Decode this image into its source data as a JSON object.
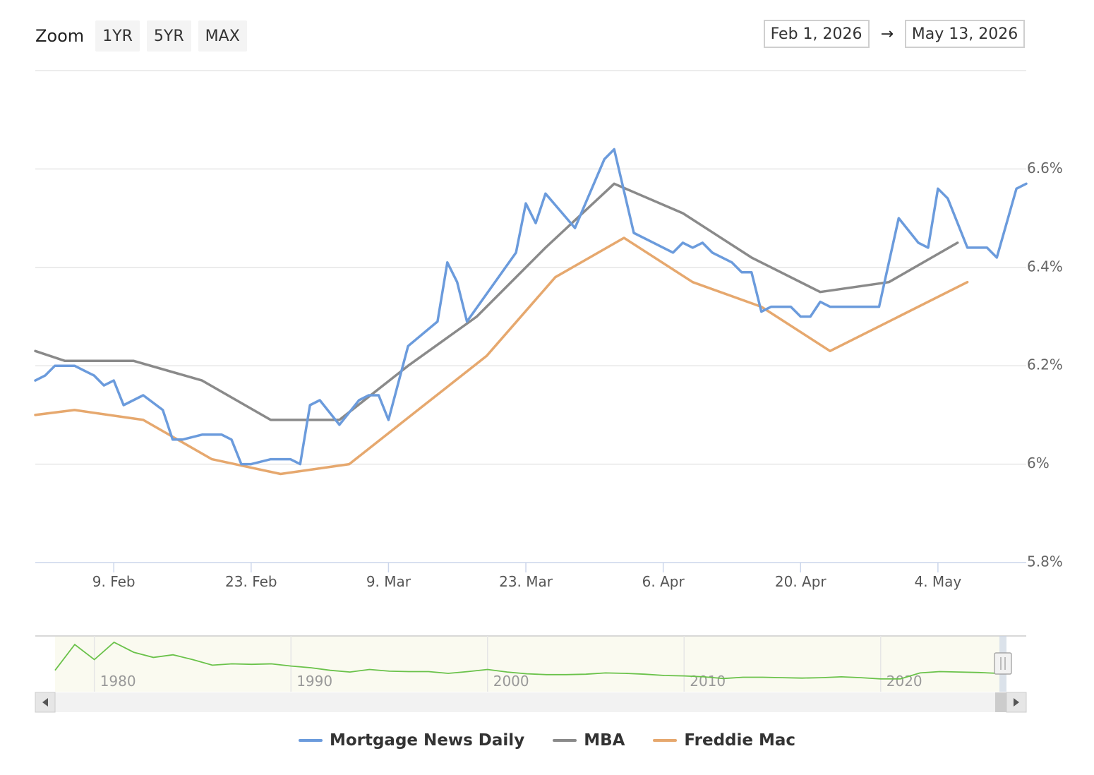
{
  "zoom": {
    "label": "Zoom",
    "buttons": [
      "1YR",
      "5YR",
      "MAX"
    ]
  },
  "range": {
    "from": "Feb 1, 2026",
    "arrow": "→",
    "to": "May 13, 2026"
  },
  "chart_data": {
    "type": "line",
    "title": "",
    "xlabel": "",
    "ylabel": "",
    "ylim": [
      5.8,
      6.6
    ],
    "xlim": [
      "2026-02-01",
      "2026-05-13"
    ],
    "y_ticks": [
      5.8,
      6.0,
      6.2,
      6.4,
      6.6
    ],
    "y_tick_labels": [
      "5.8%",
      "6%",
      "6.2%",
      "6.4%",
      "6.6%"
    ],
    "x_ticks": [
      "2026-02-09",
      "2026-02-23",
      "2026-03-09",
      "2026-03-23",
      "2026-04-06",
      "2026-04-20",
      "2026-05-04"
    ],
    "x_tick_labels": [
      "9. Feb",
      "23. Feb",
      "9. Mar",
      "23. Mar",
      "6. Apr",
      "20. Apr",
      "4. May"
    ],
    "grid": true,
    "legend": "bottom-center",
    "series": [
      {
        "name": "Mortgage News Daily",
        "color": "#6b9bdc",
        "points": [
          [
            "2026-02-01",
            6.17
          ],
          [
            "2026-02-02",
            6.18
          ],
          [
            "2026-02-03",
            6.2
          ],
          [
            "2026-02-04",
            6.2
          ],
          [
            "2026-02-05",
            6.2
          ],
          [
            "2026-02-06",
            6.19
          ],
          [
            "2026-02-07",
            6.18
          ],
          [
            "2026-02-08",
            6.16
          ],
          [
            "2026-02-09",
            6.17
          ],
          [
            "2026-02-10",
            6.12
          ],
          [
            "2026-02-12",
            6.14
          ],
          [
            "2026-02-14",
            6.11
          ],
          [
            "2026-02-15",
            6.05
          ],
          [
            "2026-02-16",
            6.05
          ],
          [
            "2026-02-18",
            6.06
          ],
          [
            "2026-02-20",
            6.06
          ],
          [
            "2026-02-21",
            6.05
          ],
          [
            "2026-02-22",
            6.0
          ],
          [
            "2026-02-23",
            6.0
          ],
          [
            "2026-02-25",
            6.01
          ],
          [
            "2026-02-27",
            6.01
          ],
          [
            "2026-02-28",
            6.0
          ],
          [
            "2026-03-01",
            6.12
          ],
          [
            "2026-03-02",
            6.13
          ],
          [
            "2026-03-04",
            6.08
          ],
          [
            "2026-03-06",
            6.13
          ],
          [
            "2026-03-07",
            6.14
          ],
          [
            "2026-03-08",
            6.14
          ],
          [
            "2026-03-09",
            6.09
          ],
          [
            "2026-03-11",
            6.24
          ],
          [
            "2026-03-14",
            6.29
          ],
          [
            "2026-03-15",
            6.41
          ],
          [
            "2026-03-16",
            6.37
          ],
          [
            "2026-03-17",
            6.29
          ],
          [
            "2026-03-22",
            6.43
          ],
          [
            "2026-03-23",
            6.53
          ],
          [
            "2026-03-24",
            6.49
          ],
          [
            "2026-03-25",
            6.55
          ],
          [
            "2026-03-28",
            6.48
          ],
          [
            "2026-03-31",
            6.62
          ],
          [
            "2026-04-01",
            6.64
          ],
          [
            "2026-04-03",
            6.47
          ],
          [
            "2026-04-05",
            6.45
          ],
          [
            "2026-04-06",
            6.44
          ],
          [
            "2026-04-07",
            6.43
          ],
          [
            "2026-04-08",
            6.45
          ],
          [
            "2026-04-09",
            6.44
          ],
          [
            "2026-04-10",
            6.45
          ],
          [
            "2026-04-11",
            6.43
          ],
          [
            "2026-04-13",
            6.41
          ],
          [
            "2026-04-14",
            6.39
          ],
          [
            "2026-04-15",
            6.39
          ],
          [
            "2026-04-16",
            6.31
          ],
          [
            "2026-04-17",
            6.32
          ],
          [
            "2026-04-18",
            6.32
          ],
          [
            "2026-04-19",
            6.32
          ],
          [
            "2026-04-20",
            6.3
          ],
          [
            "2026-04-21",
            6.3
          ],
          [
            "2026-04-22",
            6.33
          ],
          [
            "2026-04-23",
            6.32
          ],
          [
            "2026-04-25",
            6.32
          ],
          [
            "2026-04-27",
            6.32
          ],
          [
            "2026-04-28",
            6.32
          ],
          [
            "2026-04-30",
            6.5
          ],
          [
            "2026-05-02",
            6.45
          ],
          [
            "2026-05-03",
            6.44
          ],
          [
            "2026-05-04",
            6.56
          ],
          [
            "2026-05-05",
            6.54
          ],
          [
            "2026-05-07",
            6.44
          ],
          [
            "2026-05-08",
            6.44
          ],
          [
            "2026-05-09",
            6.44
          ],
          [
            "2026-05-10",
            6.42
          ],
          [
            "2026-05-12",
            6.56
          ],
          [
            "2026-05-13",
            6.57
          ]
        ]
      },
      {
        "name": "MBA",
        "color": "#8a8a8a",
        "points": [
          [
            "2026-02-01",
            6.23
          ],
          [
            "2026-02-04",
            6.21
          ],
          [
            "2026-02-11",
            6.21
          ],
          [
            "2026-02-18",
            6.17
          ],
          [
            "2026-02-25",
            6.09
          ],
          [
            "2026-03-04",
            6.09
          ],
          [
            "2026-03-11",
            6.2
          ],
          [
            "2026-03-18",
            6.3
          ],
          [
            "2026-03-25",
            6.44
          ],
          [
            "2026-04-01",
            6.57
          ],
          [
            "2026-04-08",
            6.51
          ],
          [
            "2026-04-15",
            6.42
          ],
          [
            "2026-04-22",
            6.35
          ],
          [
            "2026-04-29",
            6.37
          ],
          [
            "2026-05-06",
            6.45
          ]
        ]
      },
      {
        "name": "Freddie Mac",
        "color": "#e6a86e",
        "points": [
          [
            "2026-02-01",
            6.1
          ],
          [
            "2026-02-05",
            6.11
          ],
          [
            "2026-02-12",
            6.09
          ],
          [
            "2026-02-19",
            6.01
          ],
          [
            "2026-02-26",
            5.98
          ],
          [
            "2026-03-05",
            6.0
          ],
          [
            "2026-03-12",
            6.11
          ],
          [
            "2026-03-19",
            6.22
          ],
          [
            "2026-03-26",
            6.38
          ],
          [
            "2026-04-02",
            6.46
          ],
          [
            "2026-04-09",
            6.37
          ],
          [
            "2026-04-16",
            6.32
          ],
          [
            "2026-04-23",
            6.23
          ],
          [
            "2026-04-30",
            6.3
          ],
          [
            "2026-05-07",
            6.37
          ]
        ]
      }
    ]
  },
  "navigator": {
    "year_labels": [
      "1980",
      "1990",
      "2000",
      "2010",
      "2020"
    ],
    "series_color": "#6ac24a",
    "fill_color": "#fafaf0",
    "values": [
      [
        "1978",
        0.3
      ],
      [
        "1979",
        0.9
      ],
      [
        "1980",
        0.55
      ],
      [
        "1981",
        0.95
      ],
      [
        "1982",
        0.72
      ],
      [
        "1983",
        0.6
      ],
      [
        "1984",
        0.66
      ],
      [
        "1985",
        0.55
      ],
      [
        "1986",
        0.42
      ],
      [
        "1987",
        0.45
      ],
      [
        "1988",
        0.44
      ],
      [
        "1989",
        0.45
      ],
      [
        "1990",
        0.4
      ],
      [
        "1991",
        0.36
      ],
      [
        "1992",
        0.3
      ],
      [
        "1993",
        0.26
      ],
      [
        "1994",
        0.32
      ],
      [
        "1995",
        0.28
      ],
      [
        "1996",
        0.27
      ],
      [
        "1997",
        0.27
      ],
      [
        "1998",
        0.23
      ],
      [
        "1999",
        0.27
      ],
      [
        "2000",
        0.32
      ],
      [
        "2001",
        0.26
      ],
      [
        "2002",
        0.22
      ],
      [
        "2003",
        0.2
      ],
      [
        "2004",
        0.2
      ],
      [
        "2005",
        0.21
      ],
      [
        "2006",
        0.24
      ],
      [
        "2007",
        0.23
      ],
      [
        "2008",
        0.21
      ],
      [
        "2009",
        0.18
      ],
      [
        "2010",
        0.17
      ],
      [
        "2011",
        0.15
      ],
      [
        "2012",
        0.11
      ],
      [
        "2013",
        0.14
      ],
      [
        "2014",
        0.14
      ],
      [
        "2015",
        0.13
      ],
      [
        "2016",
        0.12
      ],
      [
        "2017",
        0.13
      ],
      [
        "2018",
        0.15
      ],
      [
        "2019",
        0.13
      ],
      [
        "2020",
        0.1
      ],
      [
        "2021",
        0.1
      ],
      [
        "2022",
        0.24
      ],
      [
        "2023",
        0.27
      ],
      [
        "2024",
        0.26
      ],
      [
        "2025",
        0.25
      ],
      [
        "2026",
        0.23
      ]
    ]
  }
}
